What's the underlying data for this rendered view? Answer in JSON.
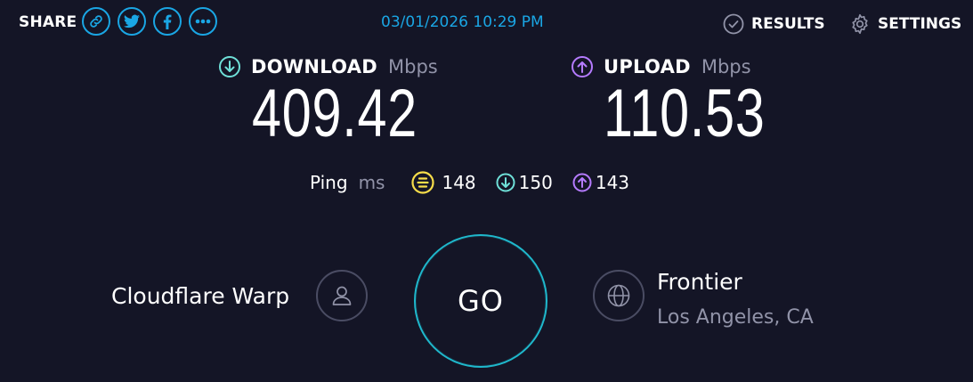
{
  "header": {
    "share_label": "SHARE",
    "share_icons": [
      "link-icon",
      "twitter-icon",
      "facebook-icon",
      "more-icon"
    ],
    "datetime": "03/01/2026 10:29 PM",
    "results_label": "RESULTS",
    "settings_label": "SETTINGS"
  },
  "download": {
    "label": "DOWNLOAD",
    "unit": "Mbps",
    "value": "409.42",
    "color": "#6fe0d8"
  },
  "upload": {
    "label": "UPLOAD",
    "unit": "Mbps",
    "value": "110.53",
    "color": "#b57bff"
  },
  "ping": {
    "label": "Ping",
    "unit": "ms",
    "idle": "148",
    "download": "150",
    "upload": "143",
    "idle_color": "#f7dd4a"
  },
  "client": {
    "isp": "Cloudflare Warp"
  },
  "go_label": "GO",
  "server": {
    "name": "Frontier",
    "location": "Los Angeles, CA"
  },
  "colors": {
    "background": "#141526",
    "accent": "#1aa6e4",
    "go_ring": "#1fb8cc"
  }
}
